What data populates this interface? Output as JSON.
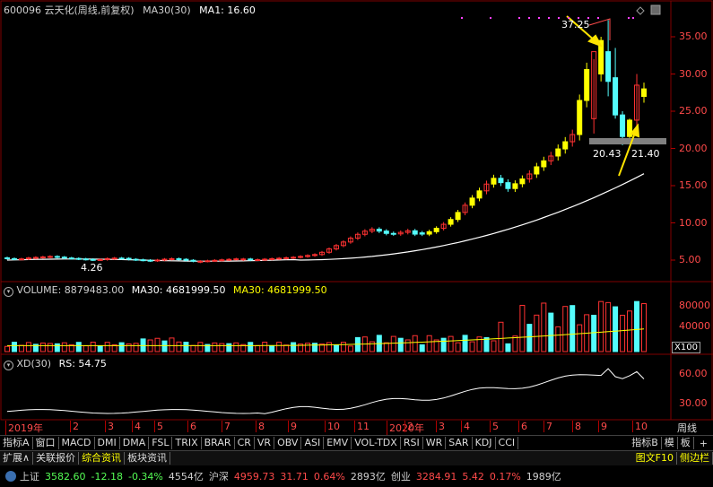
{
  "header": {
    "code_name": "600096 云天化(周线,前复权)",
    "ma_main": "MA30(30)",
    "ma1": "MA1: 16.60",
    "volume_title": "VOLUME: 8879483.00",
    "volume_ma_white": "MA30: 4681999.50",
    "volume_ma_yellow": "MA30: 4681999.50",
    "xd_title": "XD(30)",
    "xd_rs": "RS: 54.75"
  },
  "annotations": {
    "high_label": "37.25",
    "low_label_a": "20.43",
    "low_label_b": "21.40",
    "start_label": "4.26",
    "volume_unit": "X100"
  },
  "price_axis": [
    "35.00",
    "30.00",
    "25.00",
    "20.00",
    "15.00",
    "10.00",
    "5.00"
  ],
  "volume_axis": [
    "80000",
    "40000"
  ],
  "xd_axis": [
    "60.00",
    "30.00"
  ],
  "time_axis": [
    "2019年",
    "2",
    "3",
    "4",
    "5",
    "6",
    "7",
    "8",
    "9",
    "10",
    "11",
    "12",
    "2020年",
    "2",
    "3",
    "4",
    "5",
    "6",
    "7",
    "8",
    "9",
    "10"
  ],
  "period_label": "周线",
  "indicator_tabs": [
    "指标A",
    "窗口",
    "MACD",
    "DMI",
    "DMA",
    "FSL",
    "TRIX",
    "BRAR",
    "CR",
    "VR",
    "OBV",
    "ASI",
    "EMV",
    "VOL-TDX",
    "RSI",
    "WR",
    "SAR",
    "KDJ",
    "CCI"
  ],
  "indicator_right": [
    "指标B",
    "模",
    "板"
  ],
  "bottom_tabs": [
    "扩展∧",
    "关联报价",
    "综合资讯",
    "板块资讯"
  ],
  "bottom_right": [
    "图文F10",
    "侧边栏"
  ],
  "status_bar": {
    "sh_label": "上证",
    "sh_value": "3582.60",
    "sh_change": "-12.18",
    "sh_pct": "-0.34%",
    "sh_amount": "4554亿",
    "sz_label": "沪深",
    "sz_value": "4959.73",
    "sz_change": "31.71",
    "sz_pct": "0.64%",
    "sz_amount": "2893亿",
    "cy_label": "创业",
    "cy_value": "3284.91",
    "cy_change": "5.42",
    "cy_pct": "0.17%",
    "cy_amount": "1989亿"
  },
  "colors": {
    "up": "#ff3232",
    "down": "#54fcfc",
    "yellow": "#ffff00",
    "ma": "#ffffff",
    "axis": "#b00000",
    "bg": "#000000"
  },
  "chart_data": {
    "type": "candlestick",
    "price_ylim": [
      2.5,
      39
    ],
    "weekly_close_approx": [
      5.2,
      5.1,
      5.3,
      5.4,
      5.5,
      5.3,
      5.2,
      5.1,
      5.0,
      5.2,
      5.3,
      5.1,
      5.0,
      4.9,
      5.1,
      5.2,
      5.0,
      4.8,
      4.9,
      5.0,
      5.1,
      5.2,
      5.0,
      5.1,
      5.2,
      5.3,
      5.4,
      5.6,
      5.8,
      6.5,
      7.2,
      8.0,
      8.8,
      9.2,
      8.6,
      8.5,
      9.0,
      8.3,
      8.8,
      9.5,
      10.5,
      12.0,
      13.5,
      15.0,
      16.2,
      14.5,
      15.5,
      16.5,
      18.0,
      19.0,
      20.5,
      22.0,
      30.0,
      33.0,
      24.0,
      21.5,
      24.5,
      28.0
    ],
    "ma30_approx": [
      5.1,
      5.1,
      5.1,
      5.1,
      5.2,
      5.2,
      5.2,
      5.2,
      5.2,
      5.2,
      5.3,
      5.3,
      5.3,
      5.4,
      5.5,
      5.6,
      5.8,
      6.0,
      6.3,
      6.6,
      7.0,
      7.5,
      8.1,
      8.8,
      9.6,
      10.5,
      11.6,
      12.8,
      14.0,
      15.2,
      16.6
    ],
    "volume_ylim": [
      0,
      95000
    ],
    "xd_ylim": [
      20,
      75
    ]
  }
}
